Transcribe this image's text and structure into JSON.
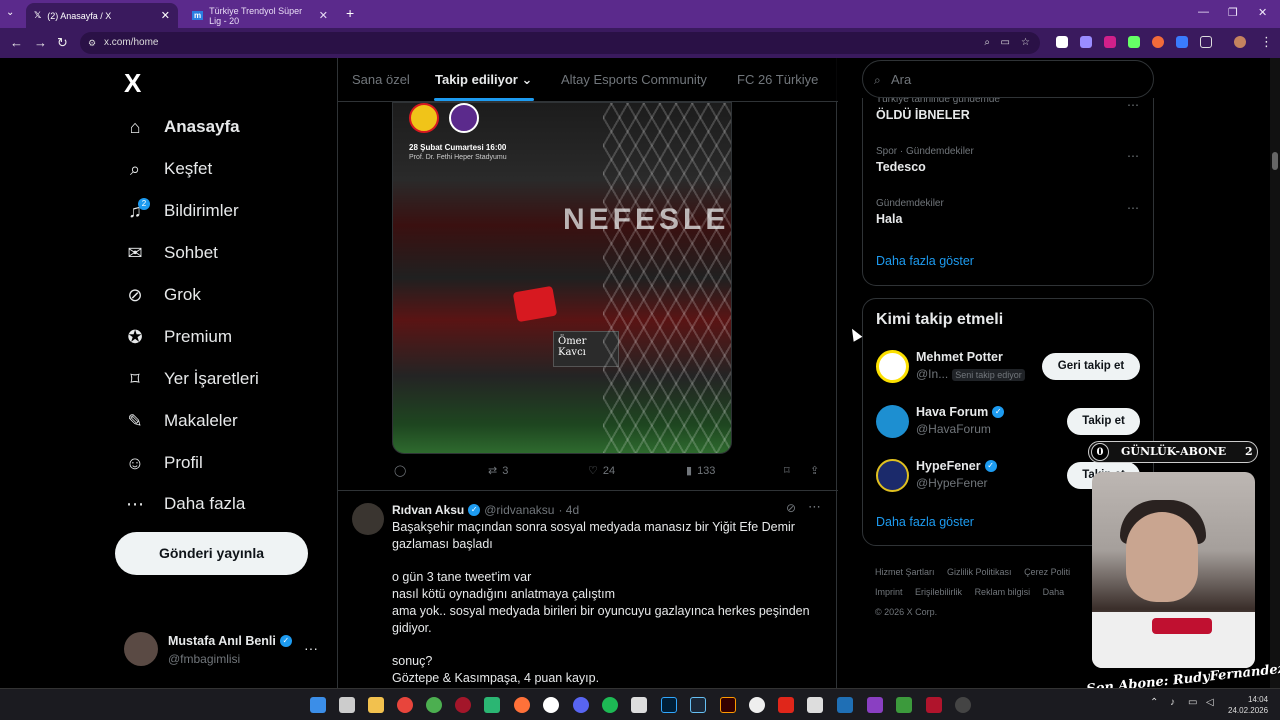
{
  "browser": {
    "tabs": [
      {
        "label": "(2) Anasayfa / X",
        "icon": "x-logo-icon",
        "active": true
      },
      {
        "label": "Türkiye Trendyol Süper Lig - 20",
        "icon": "m-icon",
        "active": false
      }
    ],
    "url": "x.com/home"
  },
  "sidebar": {
    "logo": "X",
    "items": [
      {
        "label": "Anasayfa",
        "icon": "home-icon"
      },
      {
        "label": "Keşfet",
        "icon": "search-icon"
      },
      {
        "label": "Bildirimler",
        "icon": "bell-icon",
        "badge": "2"
      },
      {
        "label": "Sohbet",
        "icon": "mail-icon"
      },
      {
        "label": "Grok",
        "icon": "grok-icon"
      },
      {
        "label": "Premium",
        "icon": "premium-icon"
      },
      {
        "label": "Yer İşaretleri",
        "icon": "bookmark-icon"
      },
      {
        "label": "Makaleler",
        "icon": "article-icon"
      },
      {
        "label": "Profil",
        "icon": "profile-icon"
      },
      {
        "label": "Daha fazla",
        "icon": "more-icon"
      }
    ],
    "post_button": "Gönderi yayınla",
    "account": {
      "name": "Mustafa Anıl Benli",
      "handle": "@fmbagimlisi",
      "more": "···"
    }
  },
  "feed": {
    "tabs": [
      "Sana özel",
      "Takip ediliyor",
      "Altay Esports Community",
      "FC 26 Türkiye"
    ],
    "active_tab": "Takip ediliyor",
    "media": {
      "date": "28 Şubat Cumartesi 16:00",
      "stadium": "Prof. Dr. Fethi Heper Stadyumu",
      "banner": "NEFESLE",
      "sign": "Ömer Kavcı"
    },
    "tweet1_actions": {
      "replies": "",
      "retweets": "3",
      "likes": "24",
      "views": "133"
    },
    "tweet2": {
      "name": "Rıdvan Aksu",
      "handle": "@ridvanaksu",
      "time": "· 4d",
      "lines": [
        "Başakşehir maçından sonra sosyal medyada manasız bir Yiğit Efe Demir gazlaması başladı",
        "",
        "o gün 3 tane tweet'im var",
        "nasıl kötü oynadığını anlatmaya çalıştım",
        "ama yok.. sosyal medyada birileri bir oyuncuyu gazlayınca herkes peşinden gidiyor.",
        "",
        "sonuç?",
        "Göztepe & Kasımpaşa, 4 puan kayıp."
      ]
    }
  },
  "right": {
    "search_placeholder": "Ara",
    "trends": [
      {
        "context": "Türkiye tarihinde gündemde",
        "name": "ÖLDÜ İBNELER"
      },
      {
        "context": "Spor · Gündemdekiler",
        "name": "Tedesco"
      },
      {
        "context": "Gündemdekiler",
        "name": "Hala"
      }
    ],
    "trends_more": "Daha fazla göster",
    "who_to_follow": {
      "title": "Kimi takip etmeli",
      "accounts": [
        {
          "name": "Mehmet Potter",
          "handle": "@In...",
          "badge": "Seni takip ediyor",
          "button": "Geri takip et",
          "verified": false
        },
        {
          "name": "Hava Forum",
          "handle": "@HavaForum",
          "badge": "",
          "button": "Takip et",
          "verified": true
        },
        {
          "name": "HypeFener",
          "handle": "@HypeFener",
          "badge": "",
          "button": "Takip et",
          "verified": true
        }
      ],
      "more": "Daha fazla göster"
    },
    "footer": {
      "links": [
        "Hizmet Şartları",
        "Gizlilik Politikası",
        "Çerez Politi",
        "Imprint",
        "Erişilebilirlik",
        "Reklam bilgisi",
        "Daha"
      ],
      "copyright": "© 2026 X Corp."
    }
  },
  "overlay": {
    "sub_left": "0",
    "sub_label": "GÜNLÜK-ABONE",
    "sub_right": "2",
    "last_sub": "Son Abone: RudyFernandez"
  },
  "taskbar": {
    "time": "14:04",
    "date": "24.02.2026"
  },
  "colors": {
    "accent": "#1d9bf0",
    "browser_frame": "#5b2a8c",
    "background": "#000000"
  }
}
